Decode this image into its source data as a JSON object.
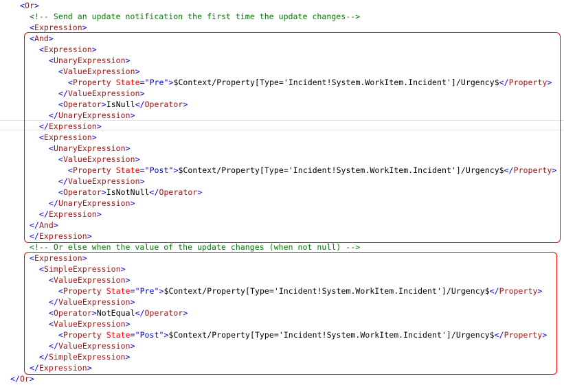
{
  "lines": [
    {
      "indent": 1,
      "parts": [
        {
          "t": "<",
          "c": "br"
        },
        {
          "t": "Or",
          "c": "tag"
        },
        {
          "t": ">",
          "c": "br"
        }
      ]
    },
    {
      "indent": 2,
      "parts": [
        {
          "t": "<!-- Send an update notification the first time the update changes-->",
          "c": "cmt"
        }
      ]
    },
    {
      "indent": 2,
      "parts": [
        {
          "t": "<",
          "c": "br"
        },
        {
          "t": "Expression",
          "c": "tag"
        },
        {
          "t": ">",
          "c": "br"
        }
      ]
    },
    {
      "indent": 2,
      "parts": [
        {
          "t": "<",
          "c": "br"
        },
        {
          "t": "And",
          "c": "tag"
        },
        {
          "t": ">",
          "c": "br"
        }
      ]
    },
    {
      "indent": 3,
      "parts": [
        {
          "t": "<",
          "c": "br"
        },
        {
          "t": "Expression",
          "c": "tag"
        },
        {
          "t": ">",
          "c": "br"
        }
      ]
    },
    {
      "indent": 4,
      "parts": [
        {
          "t": "<",
          "c": "br"
        },
        {
          "t": "UnaryExpression",
          "c": "tag"
        },
        {
          "t": ">",
          "c": "br"
        }
      ]
    },
    {
      "indent": 5,
      "parts": [
        {
          "t": "<",
          "c": "br"
        },
        {
          "t": "ValueExpression",
          "c": "tag"
        },
        {
          "t": ">",
          "c": "br"
        }
      ]
    },
    {
      "indent": 6,
      "parts": [
        {
          "t": "<",
          "c": "br"
        },
        {
          "t": "Property",
          "c": "tag"
        },
        {
          "t": " State",
          "c": "attr"
        },
        {
          "t": "=",
          "c": "br"
        },
        {
          "t": "\"Pre\"",
          "c": "val"
        },
        {
          "t": ">",
          "c": "br"
        },
        {
          "t": "$Context/Property[Type='Incident!System.WorkItem.Incident']/Urgency$",
          "c": "txt"
        },
        {
          "t": "</",
          "c": "br"
        },
        {
          "t": "Property",
          "c": "tag"
        },
        {
          "t": ">",
          "c": "br"
        }
      ]
    },
    {
      "indent": 5,
      "parts": [
        {
          "t": "</",
          "c": "br"
        },
        {
          "t": "ValueExpression",
          "c": "tag"
        },
        {
          "t": ">",
          "c": "br"
        }
      ]
    },
    {
      "indent": 5,
      "parts": [
        {
          "t": "<",
          "c": "br"
        },
        {
          "t": "Operator",
          "c": "tag"
        },
        {
          "t": ">",
          "c": "br"
        },
        {
          "t": "IsNull",
          "c": "txt"
        },
        {
          "t": "</",
          "c": "br"
        },
        {
          "t": "Operator",
          "c": "tag"
        },
        {
          "t": ">",
          "c": "br"
        }
      ]
    },
    {
      "indent": 4,
      "parts": [
        {
          "t": "</",
          "c": "br"
        },
        {
          "t": "UnaryExpression",
          "c": "tag"
        },
        {
          "t": ">",
          "c": "br"
        }
      ]
    },
    {
      "indent": 3,
      "parts": [
        {
          "t": "</",
          "c": "br"
        },
        {
          "t": "Expression",
          "c": "tag"
        },
        {
          "t": ">",
          "c": "br"
        }
      ]
    },
    {
      "indent": 3,
      "parts": [
        {
          "t": "<",
          "c": "br"
        },
        {
          "t": "Expression",
          "c": "tag"
        },
        {
          "t": ">",
          "c": "br"
        }
      ]
    },
    {
      "indent": 4,
      "parts": [
        {
          "t": "<",
          "c": "br"
        },
        {
          "t": "UnaryExpression",
          "c": "tag"
        },
        {
          "t": ">",
          "c": "br"
        }
      ]
    },
    {
      "indent": 5,
      "parts": [
        {
          "t": "<",
          "c": "br"
        },
        {
          "t": "ValueExpression",
          "c": "tag"
        },
        {
          "t": ">",
          "c": "br"
        }
      ]
    },
    {
      "indent": 6,
      "parts": [
        {
          "t": "<",
          "c": "br"
        },
        {
          "t": "Property",
          "c": "tag"
        },
        {
          "t": " State",
          "c": "attr"
        },
        {
          "t": "=",
          "c": "br"
        },
        {
          "t": "\"Post\"",
          "c": "val"
        },
        {
          "t": ">",
          "c": "br"
        },
        {
          "t": "$Context/Property[Type='Incident!System.WorkItem.Incident']/Urgency$",
          "c": "txt"
        },
        {
          "t": "</",
          "c": "br"
        },
        {
          "t": "Property",
          "c": "tag"
        },
        {
          "t": ">",
          "c": "br"
        }
      ]
    },
    {
      "indent": 5,
      "parts": [
        {
          "t": "</",
          "c": "br"
        },
        {
          "t": "ValueExpression",
          "c": "tag"
        },
        {
          "t": ">",
          "c": "br"
        }
      ]
    },
    {
      "indent": 5,
      "parts": [
        {
          "t": "<",
          "c": "br"
        },
        {
          "t": "Operator",
          "c": "tag"
        },
        {
          "t": ">",
          "c": "br"
        },
        {
          "t": "IsNotNull",
          "c": "txt"
        },
        {
          "t": "</",
          "c": "br"
        },
        {
          "t": "Operator",
          "c": "tag"
        },
        {
          "t": ">",
          "c": "br"
        }
      ]
    },
    {
      "indent": 4,
      "parts": [
        {
          "t": "</",
          "c": "br"
        },
        {
          "t": "UnaryExpression",
          "c": "tag"
        },
        {
          "t": ">",
          "c": "br"
        }
      ]
    },
    {
      "indent": 3,
      "parts": [
        {
          "t": "</",
          "c": "br"
        },
        {
          "t": "Expression",
          "c": "tag"
        },
        {
          "t": ">",
          "c": "br"
        }
      ]
    },
    {
      "indent": 2,
      "parts": [
        {
          "t": "</",
          "c": "br"
        },
        {
          "t": "And",
          "c": "tag"
        },
        {
          "t": ">",
          "c": "br"
        }
      ]
    },
    {
      "indent": 2,
      "parts": [
        {
          "t": "</",
          "c": "br"
        },
        {
          "t": "Expression",
          "c": "tag"
        },
        {
          "t": ">",
          "c": "br"
        }
      ]
    },
    {
      "indent": 2,
      "parts": [
        {
          "t": "<!-- Or else when the value of the update changes (when not null) -->",
          "c": "cmt"
        }
      ]
    },
    {
      "indent": 2,
      "parts": [
        {
          "t": "<",
          "c": "br"
        },
        {
          "t": "Expression",
          "c": "tag"
        },
        {
          "t": ">",
          "c": "br"
        }
      ]
    },
    {
      "indent": 3,
      "parts": [
        {
          "t": "<",
          "c": "br"
        },
        {
          "t": "SimpleExpression",
          "c": "tag"
        },
        {
          "t": ">",
          "c": "br"
        }
      ]
    },
    {
      "indent": 4,
      "parts": [
        {
          "t": "<",
          "c": "br"
        },
        {
          "t": "ValueExpression",
          "c": "tag"
        },
        {
          "t": ">",
          "c": "br"
        }
      ]
    },
    {
      "indent": 5,
      "parts": [
        {
          "t": "<",
          "c": "br"
        },
        {
          "t": "Property",
          "c": "tag"
        },
        {
          "t": " State",
          "c": "attr"
        },
        {
          "t": "=",
          "c": "br"
        },
        {
          "t": "\"Pre\"",
          "c": "val"
        },
        {
          "t": ">",
          "c": "br"
        },
        {
          "t": "$Context/Property[Type='Incident!System.WorkItem.Incident']/Urgency$",
          "c": "txt"
        },
        {
          "t": "</",
          "c": "br"
        },
        {
          "t": "Property",
          "c": "tag"
        },
        {
          "t": ">",
          "c": "br"
        }
      ]
    },
    {
      "indent": 4,
      "parts": [
        {
          "t": "</",
          "c": "br"
        },
        {
          "t": "ValueExpression",
          "c": "tag"
        },
        {
          "t": ">",
          "c": "br"
        }
      ]
    },
    {
      "indent": 4,
      "parts": [
        {
          "t": "<",
          "c": "br"
        },
        {
          "t": "Operator",
          "c": "tag"
        },
        {
          "t": ">",
          "c": "br"
        },
        {
          "t": "NotEqual",
          "c": "txt"
        },
        {
          "t": "</",
          "c": "br"
        },
        {
          "t": "Operator",
          "c": "tag"
        },
        {
          "t": ">",
          "c": "br"
        }
      ]
    },
    {
      "indent": 4,
      "parts": [
        {
          "t": "<",
          "c": "br"
        },
        {
          "t": "ValueExpression",
          "c": "tag"
        },
        {
          "t": ">",
          "c": "br"
        }
      ]
    },
    {
      "indent": 5,
      "parts": [
        {
          "t": "<",
          "c": "br"
        },
        {
          "t": "Property",
          "c": "tag"
        },
        {
          "t": " State",
          "c": "attr"
        },
        {
          "t": "=",
          "c": "br"
        },
        {
          "t": "\"Post\"",
          "c": "val"
        },
        {
          "t": ">",
          "c": "br"
        },
        {
          "t": "$Context/Property[Type='Incident!System.WorkItem.Incident']/Urgency$",
          "c": "txt"
        },
        {
          "t": "</",
          "c": "br"
        },
        {
          "t": "Property",
          "c": "tag"
        },
        {
          "t": ">",
          "c": "br"
        }
      ]
    },
    {
      "indent": 4,
      "parts": [
        {
          "t": "</",
          "c": "br"
        },
        {
          "t": "ValueExpression",
          "c": "tag"
        },
        {
          "t": ">",
          "c": "br"
        }
      ]
    },
    {
      "indent": 3,
      "parts": [
        {
          "t": "</",
          "c": "br"
        },
        {
          "t": "SimpleExpression",
          "c": "tag"
        },
        {
          "t": ">",
          "c": "br"
        }
      ]
    },
    {
      "indent": 2,
      "parts": [
        {
          "t": "</",
          "c": "br"
        },
        {
          "t": "Expression",
          "c": "tag"
        },
        {
          "t": ">",
          "c": "br"
        }
      ]
    },
    {
      "indent": 0,
      "parts": [
        {
          "t": "</",
          "c": "br"
        },
        {
          "t": "Or",
          "c": "tag"
        },
        {
          "t": ">",
          "c": "br"
        }
      ]
    }
  ],
  "highlights": [
    {
      "first_line": 3,
      "last_line": 21
    },
    {
      "first_line": 23,
      "last_line": 33
    }
  ],
  "colors": {
    "tag": "#a31515",
    "bracket": "#0000ff",
    "attribute": "#ff0000",
    "value": "#0000ff",
    "comment": "#008000",
    "highlight_border": "#ff0000"
  }
}
